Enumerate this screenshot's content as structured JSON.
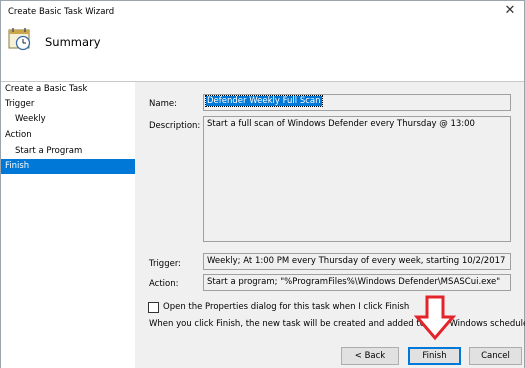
{
  "window": {
    "title": "Create Basic Task Wizard",
    "heading": "Summary",
    "close_glyph": "✕"
  },
  "sidebar": {
    "items": [
      {
        "label": "Create a Basic Task",
        "indent": false,
        "selected": false
      },
      {
        "label": "Trigger",
        "indent": false,
        "selected": false
      },
      {
        "label": "Weekly",
        "indent": true,
        "selected": false
      },
      {
        "label": "Action",
        "indent": false,
        "selected": false
      },
      {
        "label": "Start a Program",
        "indent": true,
        "selected": false
      },
      {
        "label": "Finish",
        "indent": false,
        "selected": true
      }
    ]
  },
  "summary": {
    "name_label": "Name:",
    "name_value": "Defender Weekly Full Scan",
    "description_label": "Description:",
    "description_value": "Start a full scan of Windows Defender every Thursday @ 13:00",
    "trigger_label": "Trigger:",
    "trigger_value": "Weekly; At 1:00 PM every Thursday of every week, starting 10/2/2017",
    "action_label": "Action:",
    "action_value": "Start a program; \"%ProgramFiles%\\Windows Defender\\MSASCui.exe\"",
    "open_properties_label": "Open the Properties dialog for this task when I click Finish",
    "open_properties_checked": false,
    "info_text": "When you click Finish, the new task will be created and added to your Windows schedule."
  },
  "buttons": {
    "back_label": "< Back",
    "finish_label": "Finish",
    "cancel_label": "Cancel"
  },
  "colors": {
    "accent": "#0078d7",
    "annotation_arrow": "#e3242b"
  },
  "icons": {
    "header_icon": "task-clock-icon",
    "annotation": "red-arrow-down-icon"
  }
}
